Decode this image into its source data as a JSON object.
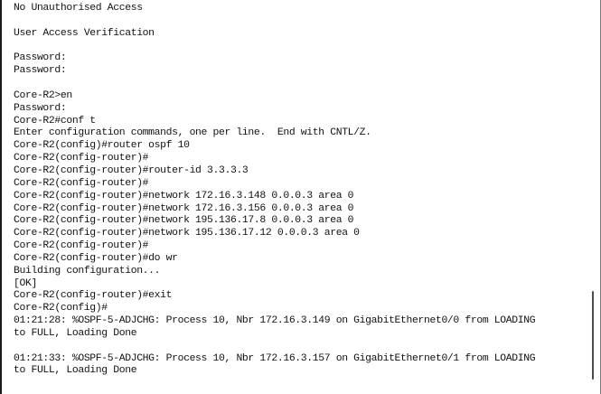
{
  "terminal": {
    "lines": [
      "No Unauthorised Access",
      "",
      "User Access Verification",
      "",
      "Password:",
      "Password:",
      "",
      "Core-R2>en",
      "Password:",
      "Core-R2#conf t",
      "Enter configuration commands, one per line.  End with CNTL/Z.",
      "Core-R2(config)#router ospf 10",
      "Core-R2(config-router)#",
      "Core-R2(config-router)#router-id 3.3.3.3",
      "Core-R2(config-router)#",
      "Core-R2(config-router)#network 172.16.3.148 0.0.0.3 area 0",
      "Core-R2(config-router)#network 172.16.3.156 0.0.0.3 area 0",
      "Core-R2(config-router)#network 195.136.17.8 0.0.0.3 area 0",
      "Core-R2(config-router)#network 195.136.17.12 0.0.0.3 area 0",
      "Core-R2(config-router)#",
      "Core-R2(config-router)#do wr",
      "Building configuration...",
      "[OK]",
      "Core-R2(config-router)#exit",
      "Core-R2(config)#",
      "01:21:28: %OSPF-5-ADJCHG: Process 10, Nbr 172.16.3.149 on GigabitEthernet0/0 from LOADING",
      "to FULL, Loading Done",
      "",
      "01:21:33: %OSPF-5-ADJCHG: Process 10, Nbr 172.16.3.157 on GigabitEthernet0/1 from LOADING",
      "to FULL, Loading Done",
      ""
    ]
  }
}
